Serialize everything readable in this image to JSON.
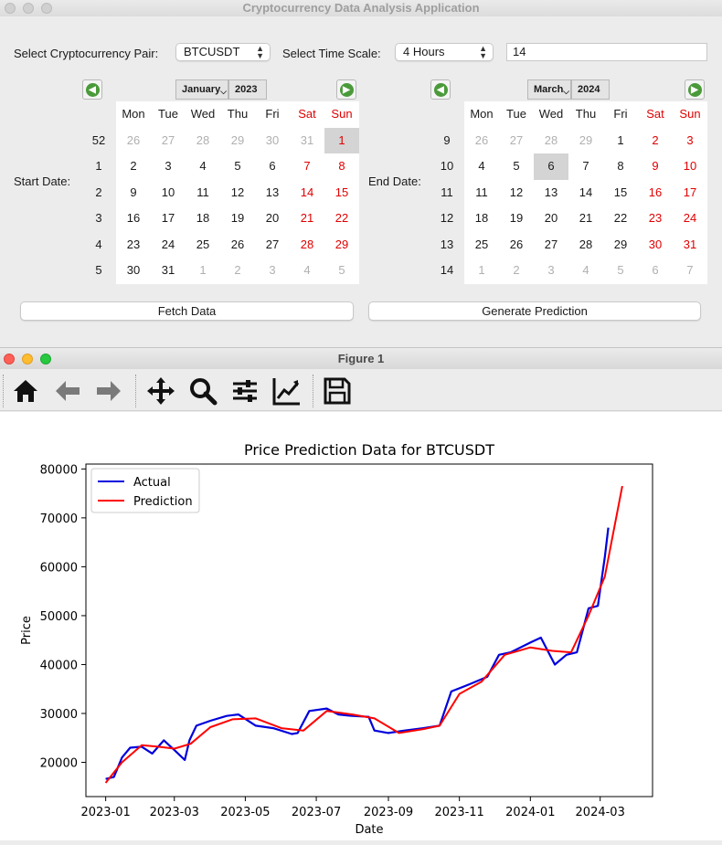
{
  "app": {
    "title": "Cryptocurrency Data Analysis Application",
    "pair_label": "Select Cryptocurrency Pair:",
    "pair_value": "BTCUSDT",
    "timescale_label": "Select Time Scale:",
    "timescale_value": "4 Hours",
    "window_value": "14",
    "start_label": "Start Date:",
    "end_label": "End Date:",
    "fetch_button": "Fetch Data",
    "predict_button": "Generate Prediction"
  },
  "weekdays": [
    "Mon",
    "Tue",
    "Wed",
    "Thu",
    "Fri",
    "Sat",
    "Sun"
  ],
  "start_calendar": {
    "month": "January",
    "year": "2023",
    "weeks": [
      "52",
      "1",
      "2",
      "3",
      "4",
      "5"
    ],
    "days": [
      [
        "26",
        "27",
        "28",
        "29",
        "30",
        "31",
        "1"
      ],
      [
        "2",
        "3",
        "4",
        "5",
        "6",
        "7",
        "8"
      ],
      [
        "9",
        "10",
        "11",
        "12",
        "13",
        "14",
        "15"
      ],
      [
        "16",
        "17",
        "18",
        "19",
        "20",
        "21",
        "22"
      ],
      [
        "23",
        "24",
        "25",
        "26",
        "27",
        "28",
        "29"
      ],
      [
        "30",
        "31",
        "1",
        "2",
        "3",
        "4",
        "5"
      ]
    ],
    "selected": "1"
  },
  "end_calendar": {
    "month": "March",
    "year": "2024",
    "weeks": [
      "9",
      "10",
      "11",
      "12",
      "13",
      "14"
    ],
    "days": [
      [
        "26",
        "27",
        "28",
        "29",
        "1",
        "2",
        "3"
      ],
      [
        "4",
        "5",
        "6",
        "7",
        "8",
        "9",
        "10"
      ],
      [
        "11",
        "12",
        "13",
        "14",
        "15",
        "16",
        "17"
      ],
      [
        "18",
        "19",
        "20",
        "21",
        "22",
        "23",
        "24"
      ],
      [
        "25",
        "26",
        "27",
        "28",
        "29",
        "30",
        "31"
      ],
      [
        "1",
        "2",
        "3",
        "4",
        "5",
        "6",
        "7"
      ]
    ],
    "selected": "6"
  },
  "figure": {
    "window_title": "Figure 1",
    "toolbar_icons": [
      "home-icon",
      "back-arrow-icon",
      "forward-arrow-icon",
      "pan-icon",
      "zoom-icon",
      "configure-subplots-icon",
      "edit-axis-icon",
      "save-icon"
    ]
  },
  "colors": {
    "actual": "#0000dd",
    "prediction": "#ff0000",
    "weekend": "#e00000",
    "nav_green": "#4a9a3a"
  },
  "chart_data": {
    "type": "line",
    "title": "Price Prediction Data for BTCUSDT",
    "xlabel": "Date",
    "ylabel": "Price",
    "xlim": [
      "2022-12-15",
      "2024-04-15"
    ],
    "ylim": [
      13000,
      81000
    ],
    "xticks": [
      "2023-01",
      "2023-03",
      "2023-05",
      "2023-07",
      "2023-09",
      "2023-11",
      "2024-01",
      "2024-03"
    ],
    "yticks": [
      20000,
      30000,
      40000,
      50000,
      60000,
      70000,
      80000
    ],
    "legend": "top-left",
    "grid": false,
    "series": [
      {
        "name": "Actual",
        "x": [
          "2023-01-01",
          "2023-01-08",
          "2023-01-15",
          "2023-01-22",
          "2023-02-01",
          "2023-02-10",
          "2023-02-20",
          "2023-03-01",
          "2023-03-10",
          "2023-03-14",
          "2023-03-20",
          "2023-04-01",
          "2023-04-15",
          "2023-04-25",
          "2023-05-10",
          "2023-05-25",
          "2023-06-10",
          "2023-06-15",
          "2023-06-25",
          "2023-07-10",
          "2023-07-20",
          "2023-08-01",
          "2023-08-15",
          "2023-08-20",
          "2023-09-01",
          "2023-09-15",
          "2023-10-01",
          "2023-10-15",
          "2023-10-25",
          "2023-11-10",
          "2023-11-25",
          "2023-12-05",
          "2023-12-15",
          "2024-01-01",
          "2024-01-10",
          "2024-01-22",
          "2024-02-01",
          "2024-02-10",
          "2024-02-20",
          "2024-02-28",
          "2024-03-05",
          "2024-03-08"
        ],
        "values": [
          16600,
          17000,
          21000,
          23000,
          23200,
          21800,
          24500,
          22500,
          20500,
          24500,
          27500,
          28500,
          29500,
          29800,
          27500,
          27000,
          25800,
          26000,
          30500,
          31000,
          29800,
          29500,
          29300,
          26500,
          26000,
          26500,
          27000,
          27500,
          34500,
          36000,
          37500,
          42000,
          42500,
          44500,
          45500,
          40000,
          42000,
          42500,
          51500,
          52000,
          62000,
          68000
        ]
      },
      {
        "name": "Prediction",
        "x": [
          "2023-01-01",
          "2023-01-15",
          "2023-02-01",
          "2023-02-15",
          "2023-03-01",
          "2023-03-15",
          "2023-04-01",
          "2023-04-20",
          "2023-05-10",
          "2023-06-01",
          "2023-06-20",
          "2023-07-10",
          "2023-08-01",
          "2023-08-20",
          "2023-09-10",
          "2023-10-01",
          "2023-10-15",
          "2023-11-01",
          "2023-11-20",
          "2023-12-10",
          "2024-01-01",
          "2024-01-20",
          "2024-02-05",
          "2024-02-20",
          "2024-03-05",
          "2024-03-20"
        ],
        "values": [
          15800,
          20000,
          23500,
          23200,
          22800,
          23800,
          27200,
          28800,
          29000,
          27000,
          26500,
          30500,
          29800,
          29000,
          26000,
          26800,
          27500,
          34000,
          36500,
          42000,
          43500,
          42800,
          42500,
          50000,
          58000,
          76500
        ]
      }
    ]
  }
}
